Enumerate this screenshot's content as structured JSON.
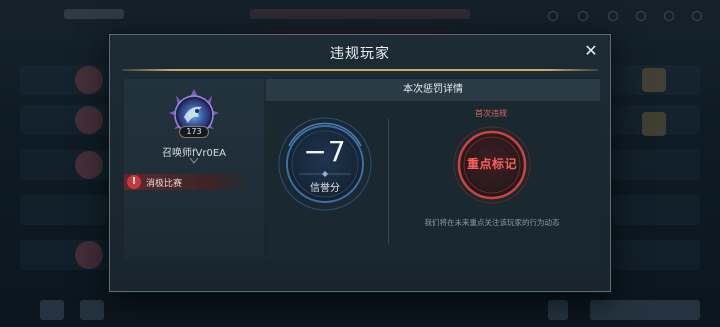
{
  "dialog": {
    "title": "违规玩家",
    "close_glyph": "✕"
  },
  "player": {
    "level": "173",
    "name": "召唤师fVr0EA",
    "violation_tag": "消极比赛",
    "warn_glyph": "!"
  },
  "detail": {
    "header": "本次惩罚详情",
    "score_value": "−7",
    "score_label": "信誉分",
    "first_violation_label": "首次违规",
    "mark_label": "重点标记",
    "mark_note": "我们将在未来重点关注该玩家的行为动态"
  },
  "colors": {
    "gold_rule": "#c9a860",
    "warn_red": "#c9383c",
    "mark_red": "#ff5f5a",
    "score_ring_blue": "#3a6fa8"
  },
  "icons": {
    "close": "close-icon",
    "warning": "warning-icon",
    "avatar": "player-avatar",
    "name_mark": "chevron-ornament-icon"
  }
}
